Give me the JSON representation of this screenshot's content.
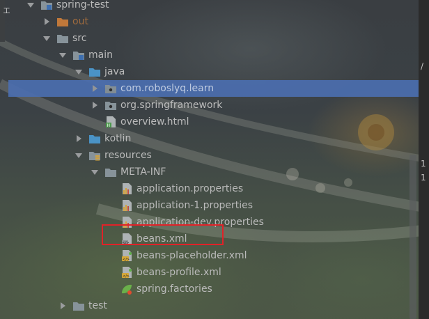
{
  "left_edge_label": "工",
  "right_gutter": [
    "1",
    "1"
  ],
  "right_gutter_marker": "/",
  "tree": [
    {
      "label": "spring-test",
      "icon": "module-folder-icon",
      "depth": 1,
      "arrow": "down"
    },
    {
      "label": "out",
      "icon": "excluded-folder-icon",
      "depth": 2,
      "arrow": "right",
      "style": "dim"
    },
    {
      "label": "src",
      "icon": "folder-icon",
      "depth": 2,
      "arrow": "down"
    },
    {
      "label": "main",
      "icon": "source-root-folder-icon",
      "depth": 3,
      "arrow": "down"
    },
    {
      "label": "java",
      "icon": "java-source-folder-icon",
      "depth": 4,
      "arrow": "down"
    },
    {
      "label": "com.roboslyq.learn",
      "icon": "package-icon",
      "depth": 5,
      "arrow": "right",
      "selected": true
    },
    {
      "label": "org.springframework",
      "icon": "package-icon",
      "depth": 5,
      "arrow": "right"
    },
    {
      "label": "overview.html",
      "icon": "html-file-icon",
      "depth": 5
    },
    {
      "label": "kotlin",
      "icon": "kotlin-source-folder-icon",
      "depth": 4,
      "arrow": "right"
    },
    {
      "label": "resources",
      "icon": "resources-folder-icon",
      "depth": 4,
      "arrow": "down"
    },
    {
      "label": "META-INF",
      "icon": "folder-icon",
      "depth": 5,
      "arrow": "down"
    },
    {
      "label": "application.properties",
      "icon": "properties-file-icon",
      "depth": 6
    },
    {
      "label": "application-1.properties",
      "icon": "properties-file-icon",
      "depth": 6
    },
    {
      "label": "application-dev.properties",
      "icon": "properties-file-icon",
      "depth": 6
    },
    {
      "label": "beans.xml",
      "icon": "xml-file-icon",
      "depth": 6,
      "highlighted": true
    },
    {
      "label": "beans-placeholder.xml",
      "icon": "spring-xml-file-icon",
      "depth": 6
    },
    {
      "label": "beans-profile.xml",
      "icon": "spring-xml-file-icon",
      "depth": 6
    },
    {
      "label": "spring.factories",
      "icon": "spring-factories-icon",
      "depth": 6
    },
    {
      "label": "test",
      "icon": "test-folder-icon",
      "depth": 3,
      "arrow": "right"
    }
  ],
  "colors": {
    "selection": "#4b6eaf",
    "annotation_box": "#e12228",
    "text": "#bbbbbb",
    "excluded_text": "#b8763c",
    "folder": "#87939a",
    "source_folder": "#4a93c6"
  }
}
